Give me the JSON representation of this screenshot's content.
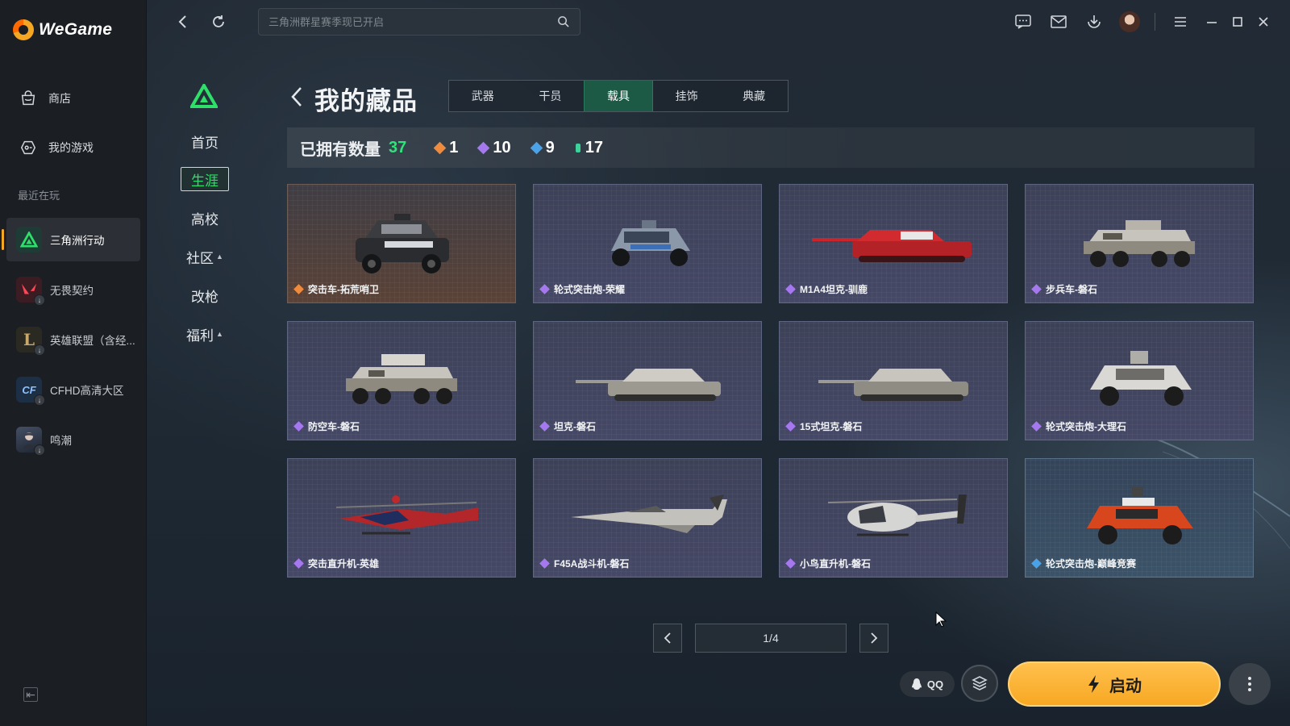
{
  "app": {
    "name": "WeGame"
  },
  "sidebar": {
    "items": [
      {
        "label": "商店",
        "icon": "store-icon"
      },
      {
        "label": "我的游戏",
        "icon": "my-games-icon"
      }
    ],
    "recent_label": "最近在玩",
    "games": [
      {
        "label": "三角洲行动",
        "active": true,
        "icon": "delta-force-icon"
      },
      {
        "label": "无畏契约",
        "active": false,
        "icon": "valorant-icon",
        "download": true
      },
      {
        "label": "英雄联盟（含经...",
        "active": false,
        "icon": "lol-icon",
        "download": true
      },
      {
        "label": "CFHD高清大区",
        "active": false,
        "icon": "cfhd-icon",
        "download": true
      },
      {
        "label": "鸣潮",
        "active": false,
        "icon": "wuthering-waves-icon",
        "download": true
      }
    ]
  },
  "topbar": {
    "search_placeholder": "三角洲群星赛季现已开启"
  },
  "game_nav": {
    "items": [
      {
        "label": "首页",
        "active": false,
        "expand": false
      },
      {
        "label": "生涯",
        "active": true,
        "expand": false
      },
      {
        "label": "高校",
        "active": false,
        "expand": false
      },
      {
        "label": "社区",
        "active": false,
        "expand": true
      },
      {
        "label": "改枪",
        "active": false,
        "expand": false
      },
      {
        "label": "福利",
        "active": false,
        "expand": true
      }
    ]
  },
  "collection": {
    "title": "我的藏品",
    "tabs": [
      {
        "label": "武器",
        "active": false
      },
      {
        "label": "干员",
        "active": false
      },
      {
        "label": "载具",
        "active": true
      },
      {
        "label": "挂饰",
        "active": false
      },
      {
        "label": "典藏",
        "active": false
      }
    ],
    "owned_label": "已拥有数量",
    "owned_total": "37",
    "rarity_counts": [
      {
        "value": "1",
        "color": "#f08a3c"
      },
      {
        "value": "10",
        "color": "#a678f0"
      },
      {
        "value": "9",
        "color": "#4aa3e8"
      },
      {
        "value": "17",
        "color": "#3bd39a"
      }
    ],
    "items": [
      {
        "name": "突击车-拓荒哨卫",
        "rarity_color": "#f08a3c",
        "theme": "orange",
        "vehicle": "suv-black"
      },
      {
        "name": "轮式突击炮-荣耀",
        "rarity_color": "#a678f0",
        "theme": "purple",
        "vehicle": "buggy-blue"
      },
      {
        "name": "M1A4坦克-驯鹿",
        "rarity_color": "#a678f0",
        "theme": "purple",
        "vehicle": "tank-red"
      },
      {
        "name": "步兵车-磐石",
        "rarity_color": "#a678f0",
        "theme": "purple",
        "vehicle": "apc-camo"
      },
      {
        "name": "防空车-磐石",
        "rarity_color": "#a678f0",
        "theme": "purple",
        "vehicle": "apc-camo"
      },
      {
        "name": "坦克-磐石",
        "rarity_color": "#a678f0",
        "theme": "purple",
        "vehicle": "tank-camo"
      },
      {
        "name": "15式坦克-磐石",
        "rarity_color": "#a678f0",
        "theme": "purple",
        "vehicle": "tank-camo"
      },
      {
        "name": "轮式突击炮-大理石",
        "rarity_color": "#a678f0",
        "theme": "purple",
        "vehicle": "suv-white"
      },
      {
        "name": "突击直升机-英雄",
        "rarity_color": "#a678f0",
        "theme": "purple",
        "vehicle": "heli-red"
      },
      {
        "name": "F45A战斗机-磐石",
        "rarity_color": "#a678f0",
        "theme": "purple",
        "vehicle": "jet-camo"
      },
      {
        "name": "小鸟直升机-磐石",
        "rarity_color": "#a678f0",
        "theme": "purple",
        "vehicle": "heli-white"
      },
      {
        "name": "轮式突击炮-巅峰竞赛",
        "rarity_color": "#4aa3e8",
        "theme": "blue",
        "vehicle": "buggy-orange"
      }
    ],
    "pagination": {
      "current": "1/4"
    }
  },
  "launch": {
    "qq_label": "QQ",
    "start_label": "启动"
  }
}
